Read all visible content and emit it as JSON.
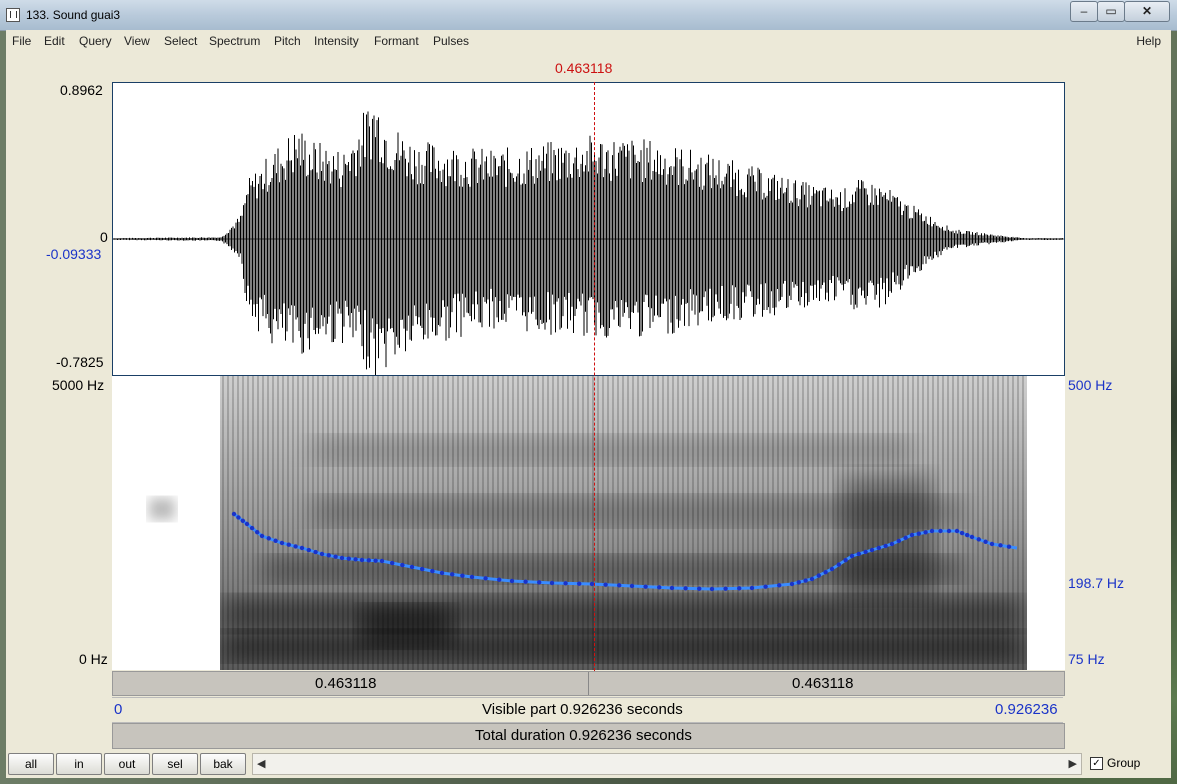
{
  "window": {
    "title": "133. Sound guai3"
  },
  "menu": [
    "File",
    "Edit",
    "Query",
    "View",
    "Select",
    "Spectrum",
    "Pitch",
    "Intensity",
    "Formant",
    "Pulses"
  ],
  "help_label": "Help",
  "cursor": {
    "label": "0.463118",
    "time": 0.463118
  },
  "waveform": {
    "ymax": "0.8962",
    "zero": "0",
    "current_value": "-0.09333",
    "ymin": "-0.7825"
  },
  "spectrogram": {
    "fmax": "5000 Hz",
    "fmin": "0 Hz"
  },
  "pitch": {
    "top": "500 Hz",
    "current": "198.7 Hz",
    "bottom": "75 Hz"
  },
  "time_bar": {
    "left_label": "0.463118",
    "right_label": "0.463118"
  },
  "visible_bar": {
    "start": "0",
    "label": "Visible part 0.926236 seconds",
    "end": "0.926236"
  },
  "total_bar": {
    "label": "Total duration 0.926236 seconds"
  },
  "buttons": [
    "all",
    "in",
    "out",
    "sel",
    "bak"
  ],
  "group_label": "Group",
  "group_checked": true,
  "colors": {
    "cursor": "#cc1111",
    "pitch": "#1a33c8",
    "pitch_line": "#3a8cff"
  }
}
